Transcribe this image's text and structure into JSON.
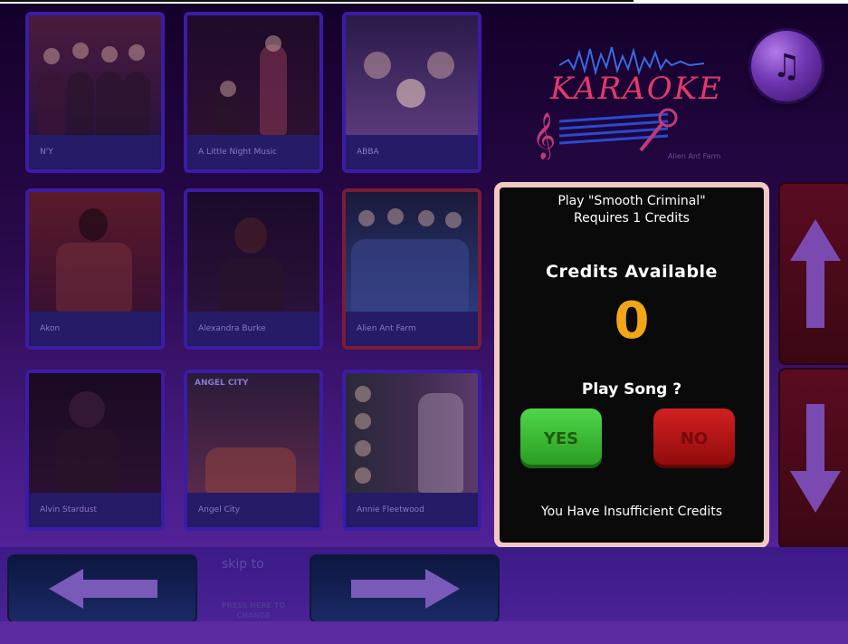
{
  "tiles": [
    {
      "caption": "N'Y"
    },
    {
      "caption": "A Little Night Music"
    },
    {
      "caption": "ABBA"
    },
    {
      "caption": "Akon"
    },
    {
      "caption": "Alexandra Burke"
    },
    {
      "caption": "Alien Ant Farm"
    },
    {
      "caption": "Alvin Stardust"
    },
    {
      "caption": "Angel City"
    },
    {
      "caption": "Annie Fleetwood"
    }
  ],
  "logo": {
    "text": "KARAOKE",
    "subtitle": "Alien Ant Farm"
  },
  "music_button": {
    "icon": "music-note-icon",
    "glyph": "♫"
  },
  "dialog": {
    "title": "Play \"Smooth Criminal\"",
    "requires": "Requires 1 Credits",
    "credits_label": "Credits Available",
    "credits_value": "0",
    "question": "Play Song ?",
    "yes_label": "YES",
    "no_label": "NO",
    "message": "You Have Insufficient Credits"
  },
  "scroll": {
    "up_icon": "arrow-up-icon",
    "down_icon": "arrow-down-icon"
  },
  "bottom": {
    "prev_icon": "arrow-left-icon",
    "next_icon": "arrow-right-icon",
    "skip_label": "skip to",
    "press_label": "PRESS HERE TO CHANGE"
  },
  "colors": {
    "accent_credits": "#f2a516",
    "yes_green": "#3cb834",
    "no_red": "#b81414",
    "dialog_border": "#f2c8c2"
  }
}
